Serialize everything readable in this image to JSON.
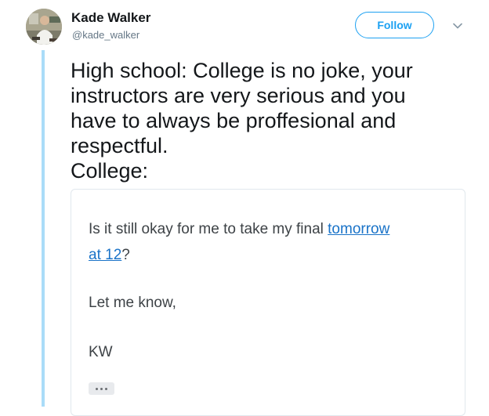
{
  "tweet": {
    "author": {
      "display_name": "Kade Walker",
      "handle": "@kade_walker",
      "avatar_icon": "user-avatar-photo"
    },
    "follow_label": "Follow",
    "more_icon": "chevron-down-icon",
    "text_lines": [
      "High school: College is no joke, your",
      "instructors are very serious and you",
      "have to always be proffesional and",
      "respectful.",
      "College:"
    ]
  },
  "email": {
    "line1_text": "Is it still okay for me to take my final ",
    "line1_link": "tomorrow",
    "line2_link": "at 12",
    "line2_text": "?",
    "signoff": "Let me know,",
    "signature": "KW",
    "more_icon": "ellipsis-icon"
  },
  "colors": {
    "brand_blue": "#1da1f2",
    "thread_line": "#aadcf8",
    "link_blue": "#1a73c8",
    "text_dark": "#14171a",
    "text_muted": "#657786"
  }
}
